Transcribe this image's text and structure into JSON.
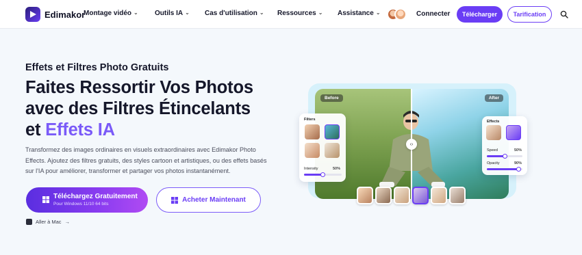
{
  "brand": {
    "name": "Edimakor"
  },
  "nav": {
    "items": [
      {
        "label": "Montage vidéo"
      },
      {
        "label": "Outils IA"
      },
      {
        "label": "Cas d'utilisation"
      },
      {
        "label": "Ressources"
      },
      {
        "label": "Assistance"
      }
    ],
    "connect_label": "Connecter",
    "download_label": "Télécharger",
    "pricing_label": "Tarification"
  },
  "hero": {
    "eyebrow": "Effets et Filtres Photo Gratuits",
    "headline_line1": "Faites Ressortir Vos Photos",
    "headline_line2": "avec des Filtres Étincelants",
    "headline_line3_prefix": "et ",
    "headline_line3_accent": "Effets IA",
    "description": "Transformez des images ordinaires en visuels extraordinaires avec Edimakor Photo Effects. Ajoutez des filtres gratuits, des styles cartoon et artistiques, ou des effets basés sur l'IA pour améliorer, transformer et partager vos photos instantanément.",
    "cta_primary": "Téléchargez Gratuitement",
    "cta_primary_sub": "Pour Windows 11/10 64 bits",
    "cta_secondary": "Acheter Maintenant",
    "mac_link": "Aller à Mac"
  },
  "showcase": {
    "before_label": "Before",
    "after_label": "After",
    "filters_panel": {
      "title": "Filters",
      "slider_label": "Intensity",
      "slider_value": "50%",
      "slider_level": 0.5
    },
    "effects_panel": {
      "title": "Effects",
      "sliders": [
        {
          "label": "Speed",
          "value": "50%",
          "level": 0.5
        },
        {
          "label": "Opacity",
          "value": "90%",
          "level": 0.9
        }
      ]
    }
  },
  "colors": {
    "accent": "#6a3df5",
    "accent_light": "#7a5af8",
    "background": "#f4f8fc"
  }
}
